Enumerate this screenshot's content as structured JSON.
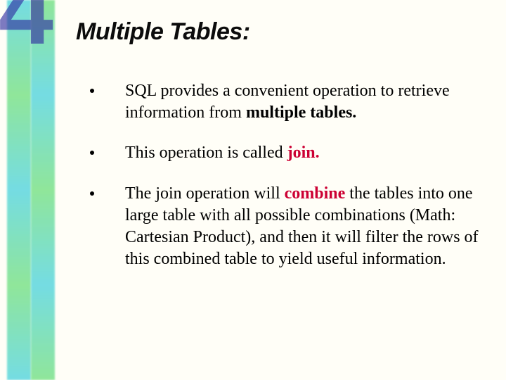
{
  "slide_number": "4",
  "title": "Multiple Tables:",
  "bullets": {
    "b1_pre": "SQL provides a convenient operation to retrieve information from ",
    "b1_bold": "multiple tables.",
    "b2_pre": "This operation is called ",
    "b2_bold": "join.",
    "b3_a": "The join operation will ",
    "b3_bold": "combine",
    "b3_b": " the tables into one large table with all possible combinations (Math: Cartesian Product), and then it will filter the rows of this combined table to yield useful information."
  }
}
